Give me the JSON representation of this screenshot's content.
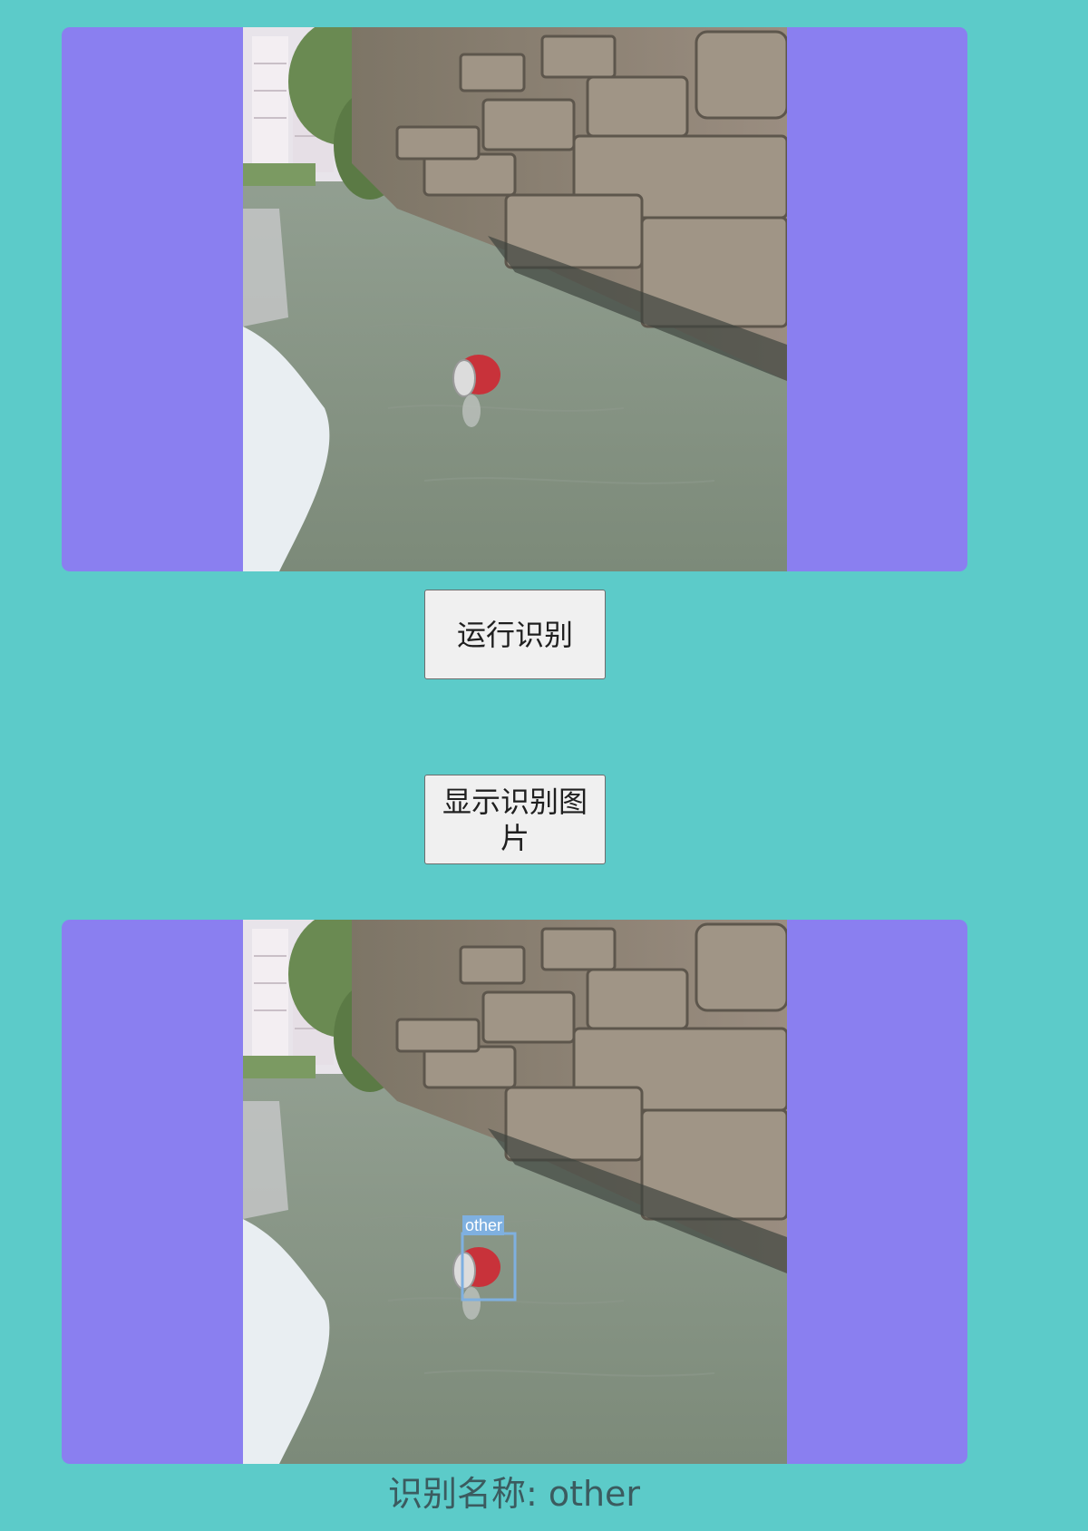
{
  "buttons": {
    "run_label": "运行识别",
    "show_label": "显示识别图片"
  },
  "detection": {
    "label": "other",
    "box_color": "#7fb0e0"
  },
  "result": {
    "text": "识别名称: other"
  },
  "colors": {
    "page_background": "#5ccbc9",
    "panel_background": "#8a7ff0"
  }
}
